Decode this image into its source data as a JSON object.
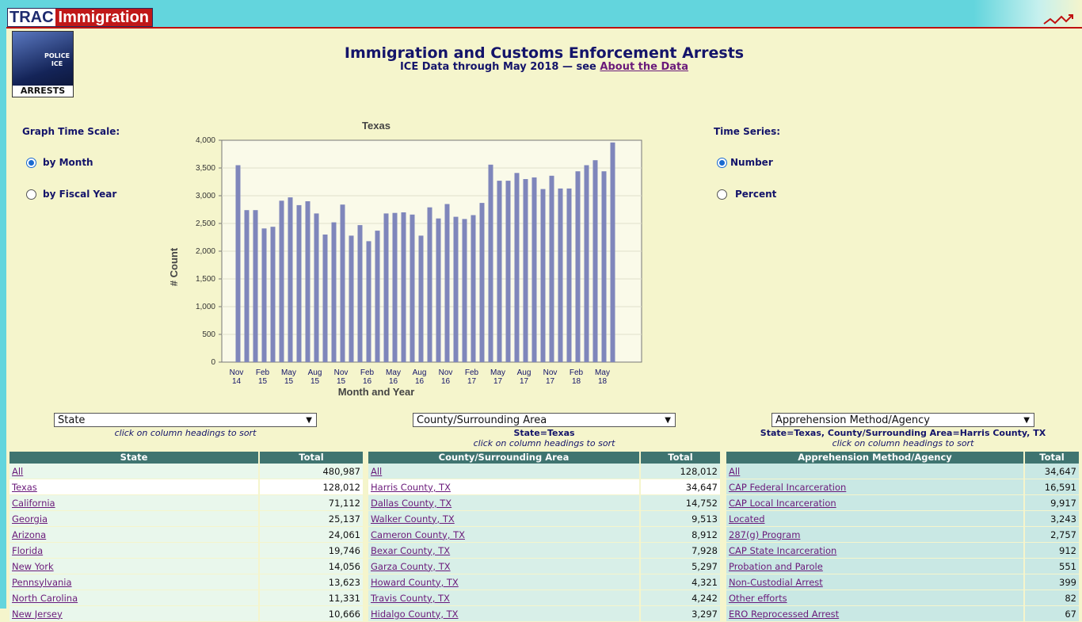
{
  "header": {
    "logo_trac": "TRAC",
    "logo_immigration": "Immigration"
  },
  "badge": {
    "police": "POLICE",
    "ice": "ICE",
    "arrests": "ARRESTS"
  },
  "page": {
    "title": "Immigration and Customs Enforcement Arrests",
    "subtitle_prefix": "ICE Data through May 2018 — see ",
    "subtitle_link": "About the Data"
  },
  "controls": {
    "time_scale_label": "Graph Time Scale:",
    "by_month": "by Month",
    "by_fiscal_year": "by Fiscal Year",
    "time_series_label": "Time Series:",
    "number": "Number",
    "percent": "Percent"
  },
  "chart_data": {
    "type": "bar",
    "title": "Texas",
    "xlabel": "Month and Year",
    "ylabel": "# Count",
    "ylim": [
      0,
      4000
    ],
    "yticks": [
      "0",
      "500",
      "1,000",
      "1,500",
      "2,000",
      "2,500",
      "3,000",
      "3,500",
      "4,000"
    ],
    "xtick_labels": [
      [
        "Nov",
        "14"
      ],
      [
        "Feb",
        "15"
      ],
      [
        "May",
        "15"
      ],
      [
        "Aug",
        "15"
      ],
      [
        "Nov",
        "15"
      ],
      [
        "Feb",
        "16"
      ],
      [
        "May",
        "16"
      ],
      [
        "Aug",
        "16"
      ],
      [
        "Nov",
        "16"
      ],
      [
        "Feb",
        "17"
      ],
      [
        "May",
        "17"
      ],
      [
        "Aug",
        "17"
      ],
      [
        "Nov",
        "17"
      ],
      [
        "Feb",
        "18"
      ],
      [
        "May",
        "18"
      ]
    ],
    "values": [
      3550,
      2740,
      2740,
      2410,
      2440,
      2910,
      2970,
      2830,
      2900,
      2680,
      2300,
      2520,
      2840,
      2280,
      2470,
      2180,
      2370,
      2680,
      2690,
      2700,
      2660,
      2280,
      2790,
      2590,
      2850,
      2620,
      2580,
      2650,
      2870,
      3560,
      3270,
      3270,
      3410,
      3300,
      3330,
      3120,
      3360,
      3130,
      3130,
      3440,
      3550,
      3640,
      3440,
      3960
    ],
    "bar_color": "#7f86bb",
    "grid": true
  },
  "col1": {
    "dropdown": "State",
    "hint": "click on column headings to sort",
    "headers": [
      "State",
      "Total"
    ],
    "rows": [
      [
        "All",
        "480,987"
      ],
      [
        "Texas",
        "128,012"
      ],
      [
        "California",
        "71,112"
      ],
      [
        "Georgia",
        "25,137"
      ],
      [
        "Arizona",
        "24,061"
      ],
      [
        "Florida",
        "19,746"
      ],
      [
        "New York",
        "14,056"
      ],
      [
        "Pennsylvania",
        "13,623"
      ],
      [
        "North Carolina",
        "11,331"
      ],
      [
        "New Jersey",
        "10,666"
      ]
    ]
  },
  "col2": {
    "dropdown": "County/Surrounding Area",
    "filter": "State=Texas",
    "hint": "click on column headings to sort",
    "headers": [
      "County/Surrounding Area",
      "Total"
    ],
    "rows": [
      [
        "All",
        "128,012"
      ],
      [
        "Harris County, TX",
        "34,647"
      ],
      [
        "Dallas County, TX",
        "14,752"
      ],
      [
        "Walker County, TX",
        "9,513"
      ],
      [
        "Cameron County, TX",
        "8,912"
      ],
      [
        "Bexar County, TX",
        "7,928"
      ],
      [
        "Garza County, TX",
        "5,297"
      ],
      [
        "Howard County, TX",
        "4,321"
      ],
      [
        "Travis County, TX",
        "4,242"
      ],
      [
        "Hidalgo County, TX",
        "3,297"
      ]
    ]
  },
  "col3": {
    "dropdown": "Apprehension Method/Agency",
    "filter": "State=Texas, County/Surrounding Area=Harris County, TX",
    "hint": "click on column headings to sort",
    "headers": [
      "Apprehension Method/Agency",
      "Total"
    ],
    "rows": [
      [
        "All",
        "34,647"
      ],
      [
        "CAP Federal Incarceration",
        "16,591"
      ],
      [
        "CAP Local Incarceration",
        "9,917"
      ],
      [
        "Located",
        "3,243"
      ],
      [
        "287(g) Program",
        "2,757"
      ],
      [
        "CAP State Incarceration",
        "912"
      ],
      [
        "Probation and Parole",
        "551"
      ],
      [
        "Non-Custodial Arrest",
        "399"
      ],
      [
        "Other efforts",
        "82"
      ],
      [
        "ERO Reprocessed Arrest",
        "67"
      ]
    ]
  }
}
